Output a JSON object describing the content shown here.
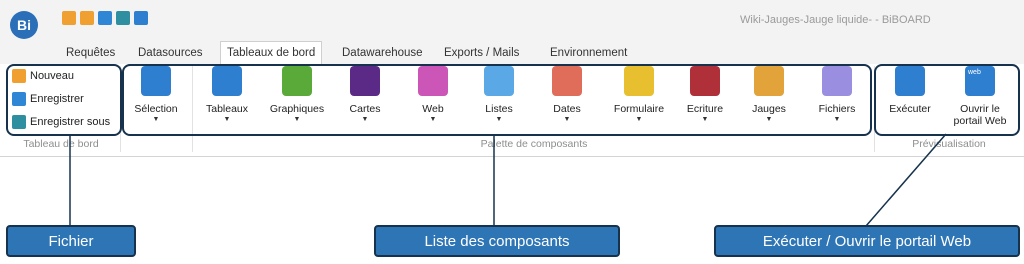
{
  "window": {
    "title": "Wiki-Jauges-Jauge liquide- - BiBOARD",
    "logo": "Bi"
  },
  "quick_access": [
    "new-file-icon",
    "new-folder-icon",
    "save-icon",
    "save-as-icon",
    "preview-icon"
  ],
  "tabs": [
    {
      "label": "Requêtes"
    },
    {
      "label": "Datasources"
    },
    {
      "label": "Tableaux de bord",
      "active": true
    },
    {
      "label": "Datawarehouse"
    },
    {
      "label": "Exports / Mails"
    },
    {
      "label": "Environnement"
    }
  ],
  "file_group": {
    "label": "Tableau de bord",
    "items": [
      {
        "label": "Nouveau",
        "color": "#f0a030"
      },
      {
        "label": "Enregistrer",
        "color": "#2f86d4"
      },
      {
        "label": "Enregistrer sous",
        "color": "#2e8fa0"
      }
    ]
  },
  "palette": {
    "label": "Palette de composants",
    "selection": {
      "label": "Sélection",
      "color": "#2f7fd1"
    },
    "items": [
      {
        "label": "Tableaux",
        "color": "#2f7fd1"
      },
      {
        "label": "Graphiques",
        "color": "#5aaa3a"
      },
      {
        "label": "Cartes",
        "color": "#5b2a86"
      },
      {
        "label": "Web",
        "color": "#cc55b8"
      },
      {
        "label": "Listes",
        "color": "#5aa9e6"
      },
      {
        "label": "Dates",
        "color": "#e06c5a"
      },
      {
        "label": "Formulaire",
        "color": "#e8c02f"
      },
      {
        "label": "Ecriture",
        "color": "#b0303a"
      },
      {
        "label": "Jauges",
        "color": "#e2a33a"
      },
      {
        "label": "Fichiers",
        "color": "#9a8ee0"
      }
    ]
  },
  "preview": {
    "label": "Prévisualisation",
    "run": {
      "label": "Exécuter",
      "color": "#2f7fd1"
    },
    "portal": {
      "label_line1": "Ouvrir le",
      "label_line2": "portail Web",
      "badge": "web",
      "color": "#2f7fd1"
    }
  },
  "callouts": {
    "fichier": "Fichier",
    "composants": "Liste des composants",
    "portail": "Exécuter / Ouvrir le portail Web"
  }
}
